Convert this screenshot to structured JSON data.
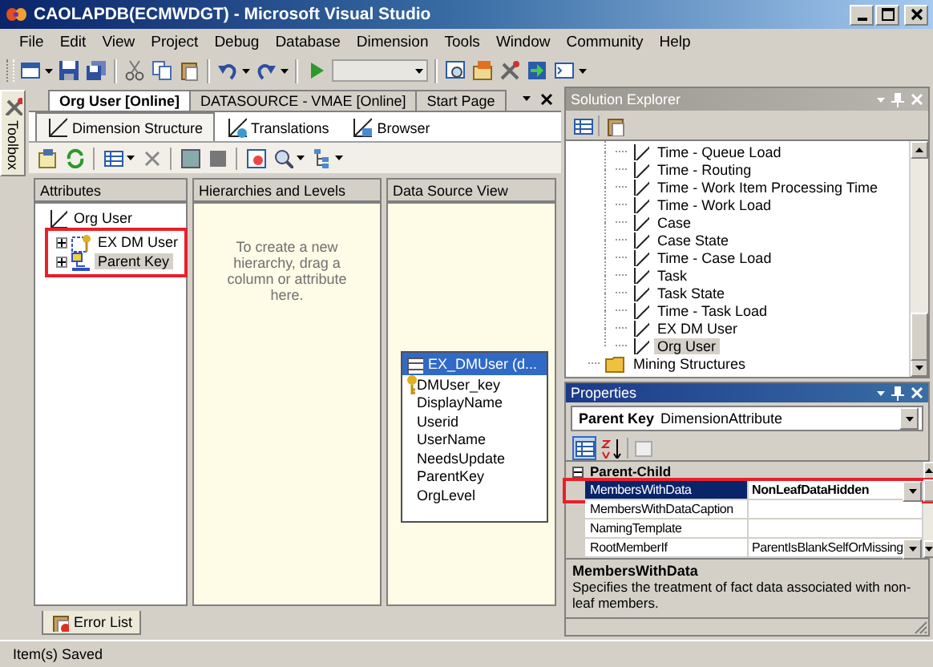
{
  "window": {
    "title": "CAOLAPDB(ECMWDGT) - Microsoft Visual Studio"
  },
  "menu": [
    {
      "label": "File"
    },
    {
      "label": "Edit"
    },
    {
      "label": "View"
    },
    {
      "label": "Project"
    },
    {
      "label": "Debug"
    },
    {
      "label": "Database"
    },
    {
      "label": "Dimension"
    },
    {
      "label": "Tools"
    },
    {
      "label": "Window"
    },
    {
      "label": "Community"
    },
    {
      "label": "Help"
    }
  ],
  "toolbox": {
    "label": "Toolbox"
  },
  "document_tabs": [
    {
      "label": "Org User [Online]",
      "selected": true
    },
    {
      "label": "DATASOURCE - VMAE [Online]",
      "selected": false
    },
    {
      "label": "Start Page",
      "selected": false
    }
  ],
  "designer_tabs": [
    {
      "label": "Dimension Structure",
      "selected": true
    },
    {
      "label": "Translations",
      "selected": false
    },
    {
      "label": "Browser",
      "selected": false
    }
  ],
  "attributes": {
    "title": "Attributes",
    "root": "Org User",
    "items": [
      {
        "label": "EX DM User",
        "kind": "key",
        "expanded": false,
        "selected": false,
        "highlighted": true
      },
      {
        "label": "Parent Key",
        "kind": "parent",
        "expanded": false,
        "selected": true,
        "highlighted": true
      }
    ]
  },
  "hierarchies": {
    "title": "Hierarchies and Levels",
    "hint": "To create a new hierarchy, drag a column or attribute here."
  },
  "data_source_view": {
    "title": "Data Source View",
    "table": {
      "title": "EX_DMUser (d...",
      "columns": [
        {
          "name": "DMUser_key",
          "key": true
        },
        {
          "name": "DisplayName",
          "key": false
        },
        {
          "name": "Userid",
          "key": false
        },
        {
          "name": "UserName",
          "key": false
        },
        {
          "name": "NeedsUpdate",
          "key": false
        },
        {
          "name": "ParentKey",
          "key": false
        },
        {
          "name": "OrgLevel",
          "key": false
        }
      ]
    }
  },
  "bottom_tabs": [
    {
      "label": "Error List"
    }
  ],
  "solution_explorer": {
    "title": "Solution Explorer",
    "items": [
      {
        "label": "Time - Queue Load",
        "kind": "dimension",
        "selected": false
      },
      {
        "label": "Time - Routing",
        "kind": "dimension",
        "selected": false
      },
      {
        "label": "Time - Work Item Processing Time",
        "kind": "dimension",
        "selected": false
      },
      {
        "label": "Time - Work Load",
        "kind": "dimension",
        "selected": false
      },
      {
        "label": "Case",
        "kind": "dimension",
        "selected": false
      },
      {
        "label": "Case State",
        "kind": "dimension",
        "selected": false
      },
      {
        "label": "Time - Case Load",
        "kind": "dimension",
        "selected": false
      },
      {
        "label": "Task",
        "kind": "dimension",
        "selected": false
      },
      {
        "label": "Task State",
        "kind": "dimension",
        "selected": false
      },
      {
        "label": "Time - Task Load",
        "kind": "dimension",
        "selected": false
      },
      {
        "label": "EX DM User",
        "kind": "dimension",
        "selected": false
      },
      {
        "label": "Org User",
        "kind": "dimension",
        "selected": true
      },
      {
        "label": "Mining Structures",
        "kind": "folder",
        "selected": false
      }
    ]
  },
  "properties": {
    "title": "Properties",
    "object_name": "Parent Key",
    "object_type": "DimensionAttribute",
    "categories": [
      {
        "label": "Parent-Child",
        "expanded": true,
        "rows": [
          {
            "name": "MembersWithData",
            "value": "NonLeafDataHidden",
            "selected": true,
            "highlighted": true,
            "dropdown": true
          },
          {
            "name": "MembersWithDataCaption",
            "selected": false,
            "highlighted": false,
            "dropdown": false
          },
          {
            "name": "NamingTemplate",
            "selected": false,
            "highlighted": false,
            "dropdown": false
          },
          {
            "name": "RootMemberIf",
            "value": "ParentIsBlankSelfOrMissing",
            "selected": false,
            "highlighted": false,
            "dropdown": true
          }
        ]
      }
    ],
    "description": {
      "title": "MembersWithData",
      "text": "Specifies the treatment of fact data associated with non-leaf members."
    }
  },
  "status_bar": {
    "text": "Item(s) Saved"
  }
}
